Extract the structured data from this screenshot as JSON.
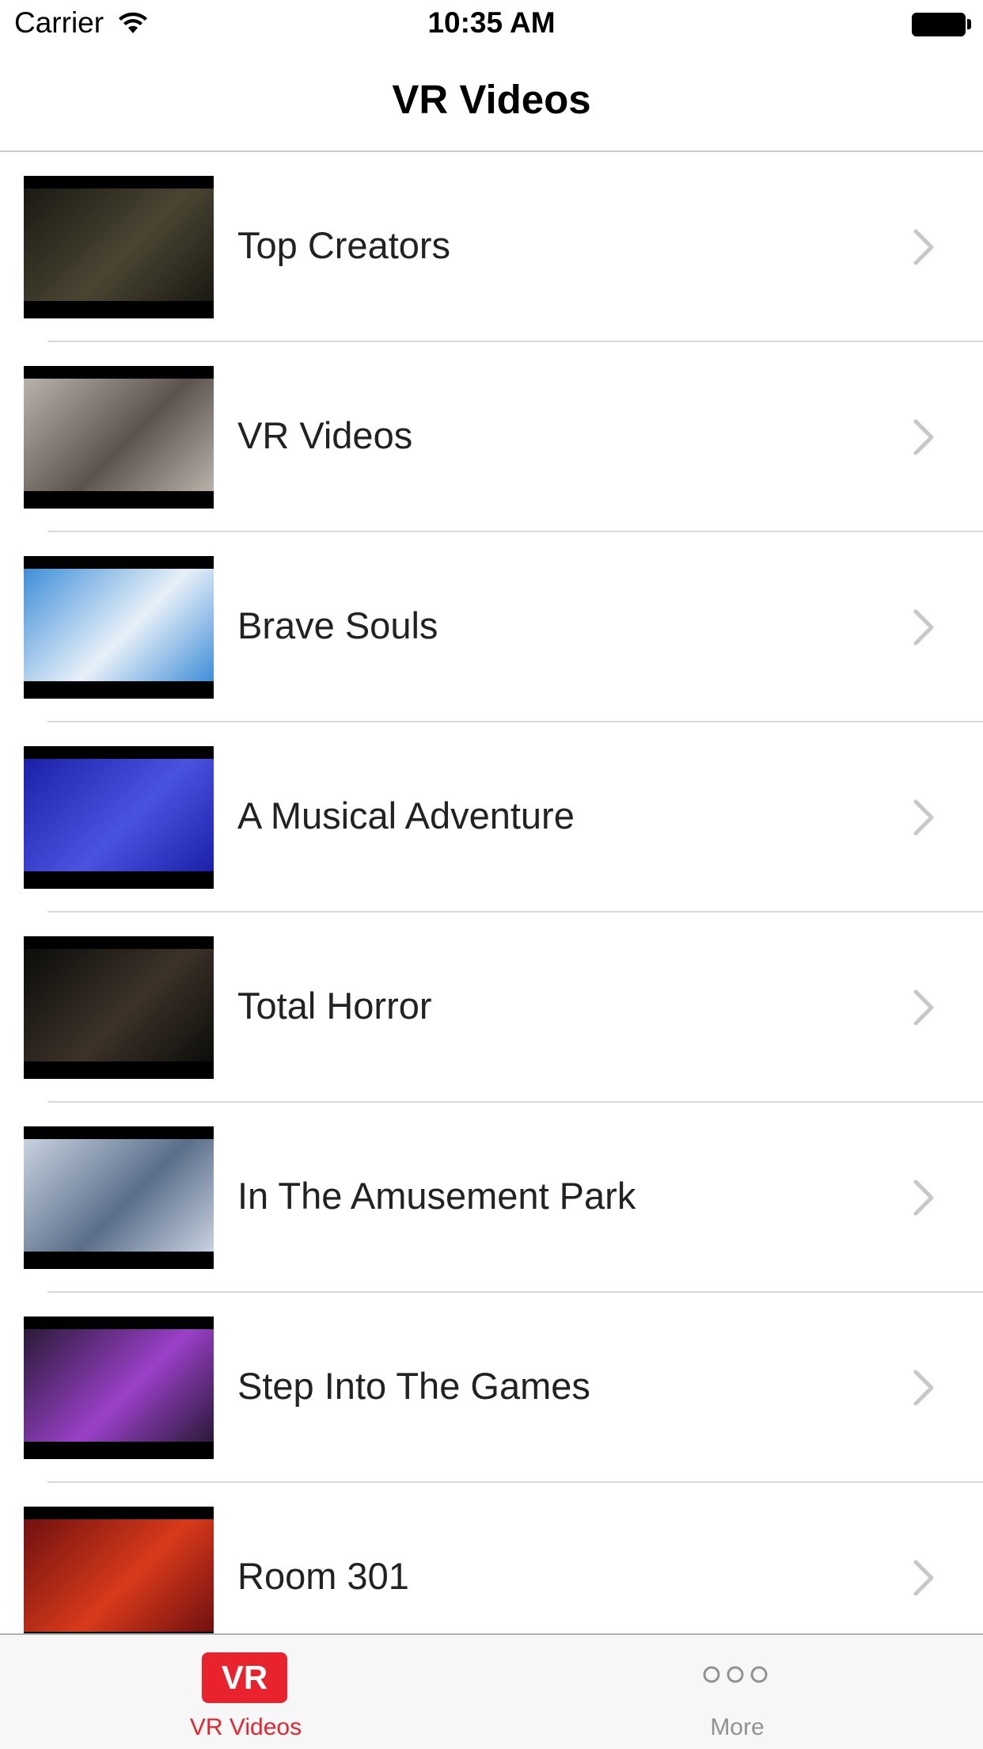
{
  "status_bar": {
    "carrier": "Carrier",
    "time": "10:35 AM",
    "wifi_icon": "wifi-icon",
    "battery_icon": "battery-full-icon"
  },
  "nav_bar": {
    "title": "VR Videos"
  },
  "list": {
    "items": [
      {
        "label": "Top Creators",
        "thumb_icon": "video-thumbnail",
        "thumb_colors": [
          "#1a1812",
          "#4a4532"
        ]
      },
      {
        "label": "VR Videos",
        "thumb_icon": "video-thumbnail",
        "thumb_colors": [
          "#b8b2aa",
          "#5c544c"
        ]
      },
      {
        "label": "Brave Souls",
        "thumb_icon": "video-thumbnail",
        "thumb_colors": [
          "#3f8ed8",
          "#e8f0f8"
        ]
      },
      {
        "label": "A Musical Adventure",
        "thumb_icon": "video-thumbnail",
        "thumb_colors": [
          "#1a20a8",
          "#4a52e0"
        ]
      },
      {
        "label": "Total Horror",
        "thumb_icon": "video-thumbnail",
        "thumb_colors": [
          "#0c0c0a",
          "#3c3228"
        ]
      },
      {
        "label": "In The Amusement Park",
        "thumb_icon": "video-thumbnail",
        "thumb_colors": [
          "#c8d2e0",
          "#5a6e8a"
        ]
      },
      {
        "label": "Step Into The Games",
        "thumb_icon": "video-thumbnail",
        "thumb_colors": [
          "#2a1a38",
          "#9a40c8"
        ]
      },
      {
        "label": "Room 301",
        "thumb_icon": "video-thumbnail",
        "thumb_colors": [
          "#701010",
          "#d83a1a"
        ]
      }
    ],
    "chevron_icon": "chevron-right-icon"
  },
  "tab_bar": {
    "tabs": [
      {
        "badge": "VR",
        "label": "VR Videos",
        "selected": true,
        "icon": "vr-icon"
      },
      {
        "label": "More",
        "selected": false,
        "icon": "more-icon"
      }
    ],
    "accent_color": "#e8232d",
    "inactive_color": "#929292"
  }
}
